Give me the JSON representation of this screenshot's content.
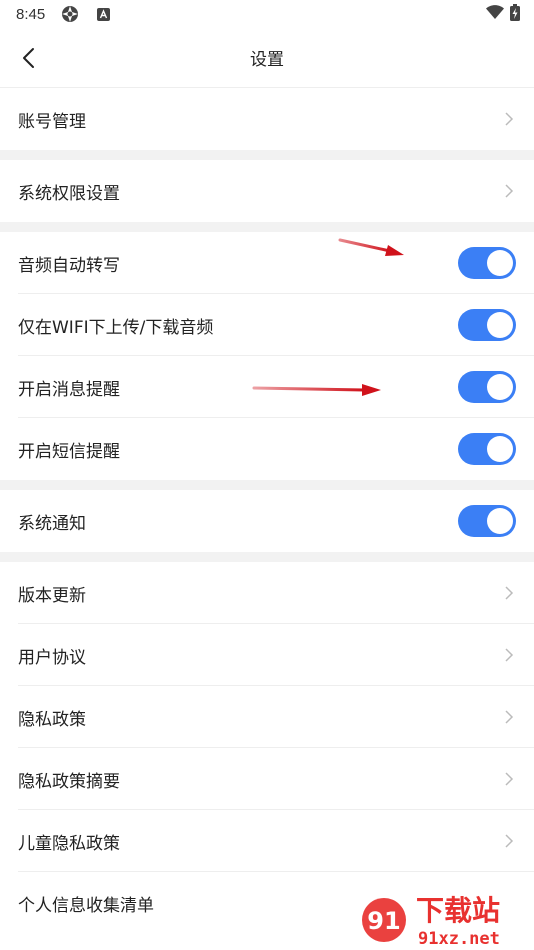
{
  "status_bar": {
    "time": "8:45",
    "icons": [
      "aperture-icon",
      "a-badge-icon",
      "wifi-icon",
      "battery-charging-icon"
    ]
  },
  "header": {
    "title": "设置",
    "back_icon": "chevron-left-icon"
  },
  "groups": {
    "account": {
      "items": [
        {
          "label": "账号管理",
          "type": "link"
        }
      ]
    },
    "permissions": {
      "items": [
        {
          "label": "系统权限设置",
          "type": "link"
        }
      ]
    },
    "audio": {
      "items": [
        {
          "label": "音频自动转写",
          "type": "toggle",
          "on": true
        },
        {
          "label": "仅在WIFI下上传/下载音频",
          "type": "toggle",
          "on": true
        },
        {
          "label": "开启消息提醒",
          "type": "toggle",
          "on": true
        },
        {
          "label": "开启短信提醒",
          "type": "toggle",
          "on": true
        }
      ]
    },
    "notify": {
      "items": [
        {
          "label": "系统通知",
          "type": "toggle",
          "on": true
        }
      ]
    },
    "about": {
      "items": [
        {
          "label": "版本更新",
          "type": "link"
        },
        {
          "label": "用户协议",
          "type": "link"
        },
        {
          "label": "隐私政策",
          "type": "link"
        },
        {
          "label": "隐私政策摘要",
          "type": "link"
        },
        {
          "label": "儿童隐私政策",
          "type": "link"
        },
        {
          "label": "个人信息收集清单",
          "type": "link"
        }
      ]
    }
  },
  "watermark": {
    "brand_mark": "91",
    "text": "下载站",
    "url": "91xz.net"
  },
  "colors": {
    "toggle_on": "#3b7ff5",
    "annotation_arrow": "#d0121b",
    "divider_band": "#f2f2f2",
    "watermark_red": "#e8312f"
  }
}
